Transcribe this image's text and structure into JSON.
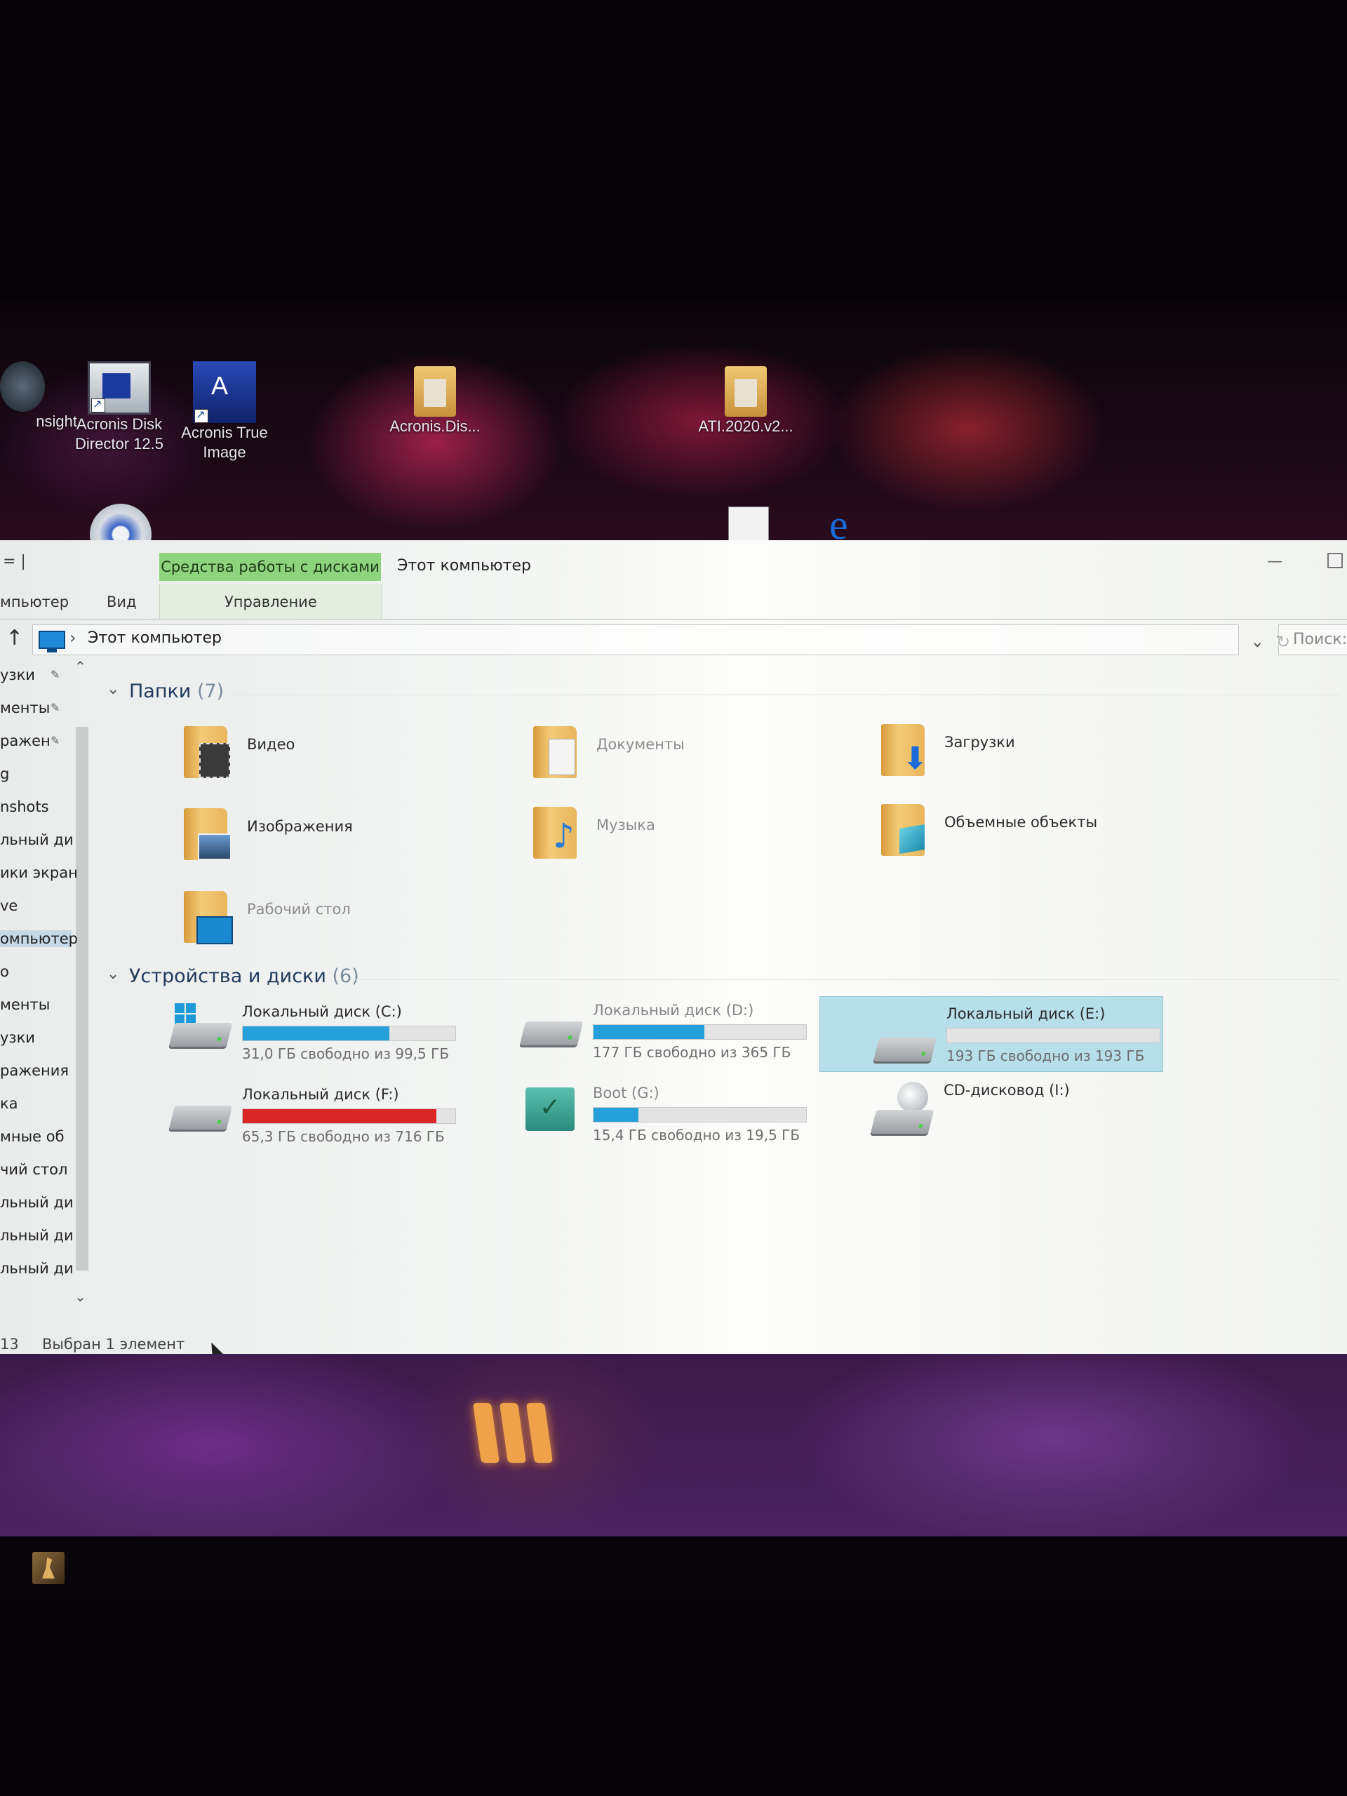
{
  "desktop": {
    "icons": [
      {
        "label": "nsight"
      },
      {
        "label": "Acronis Disk Director 12.5"
      },
      {
        "label": "Acronis True Image"
      },
      {
        "label": "Acronis.Dis..."
      },
      {
        "label": "ATI.2020.v2..."
      }
    ]
  },
  "window": {
    "title": "Этот компьютер",
    "quick_access": "= |",
    "context_tab": "Средства работы с дисками",
    "ribbon_tabs": {
      "computer": "мпьютер",
      "view": "Вид",
      "manage": "Управление"
    },
    "address": {
      "crumb": "Этот компьютер",
      "separator": "›",
      "search_placeholder": "Поиск:"
    }
  },
  "nav": {
    "items": [
      {
        "label": "узки",
        "pinned": true
      },
      {
        "label": "менты",
        "pinned": true
      },
      {
        "label": "ражен",
        "pinned": true
      },
      {
        "label": "g",
        "pinned": false
      },
      {
        "label": "nshots",
        "pinned": false
      },
      {
        "label": "льный ди",
        "pinned": false
      },
      {
        "label": "ики экран",
        "pinned": false
      },
      {
        "label": "ve",
        "pinned": false
      },
      {
        "label": "омпьютер",
        "pinned": false,
        "selected": true
      },
      {
        "label": "о",
        "pinned": false
      },
      {
        "label": "менты",
        "pinned": false
      },
      {
        "label": "узки",
        "pinned": false
      },
      {
        "label": "ражения",
        "pinned": false
      },
      {
        "label": "ка",
        "pinned": false
      },
      {
        "label": "мные об",
        "pinned": false
      },
      {
        "label": "чий стол",
        "pinned": false
      },
      {
        "label": "льный ди",
        "pinned": false
      },
      {
        "label": "льный ди",
        "pinned": false
      },
      {
        "label": "льный ди",
        "pinned": false
      }
    ]
  },
  "folders": {
    "heading": "Папки",
    "count": "(7)",
    "items": [
      {
        "label": "Видео"
      },
      {
        "label": "Документы"
      },
      {
        "label": "Загрузки"
      },
      {
        "label": "Изображения"
      },
      {
        "label": "Музыка"
      },
      {
        "label": "Объемные объекты"
      },
      {
        "label": "Рабочий стол"
      }
    ]
  },
  "devices": {
    "heading": "Устройства и диски",
    "count": "(6)",
    "items": [
      {
        "name": "Локальный диск (C:)",
        "free": "31,0 ГБ свободно из 99,5 ГБ",
        "used_fraction": 0.69,
        "bar_color": "#26a0da"
      },
      {
        "name": "Локальный диск (D:)",
        "free": "177 ГБ свободно из 365 ГБ",
        "used_fraction": 0.52,
        "bar_color": "#26a0da"
      },
      {
        "name": "Локальный диск (E:)",
        "free": "193 ГБ свободно из 193 ГБ",
        "used_fraction": 0.0,
        "bar_color": "#26a0da",
        "selected": true
      },
      {
        "name": "Локальный диск (F:)",
        "free": "65,3 ГБ свободно из 716 ГБ",
        "used_fraction": 0.91,
        "bar_color": "#da2626"
      },
      {
        "name": "Boot (G:)",
        "free": "15,4 ГБ свободно из 19,5 ГБ",
        "used_fraction": 0.21,
        "bar_color": "#26a0da"
      },
      {
        "name": "CD-дисковод (I:)",
        "free": "",
        "used_fraction": null,
        "bar_color": ""
      }
    ]
  },
  "status": {
    "count": "13",
    "selection": "Выбран 1 элемент"
  }
}
